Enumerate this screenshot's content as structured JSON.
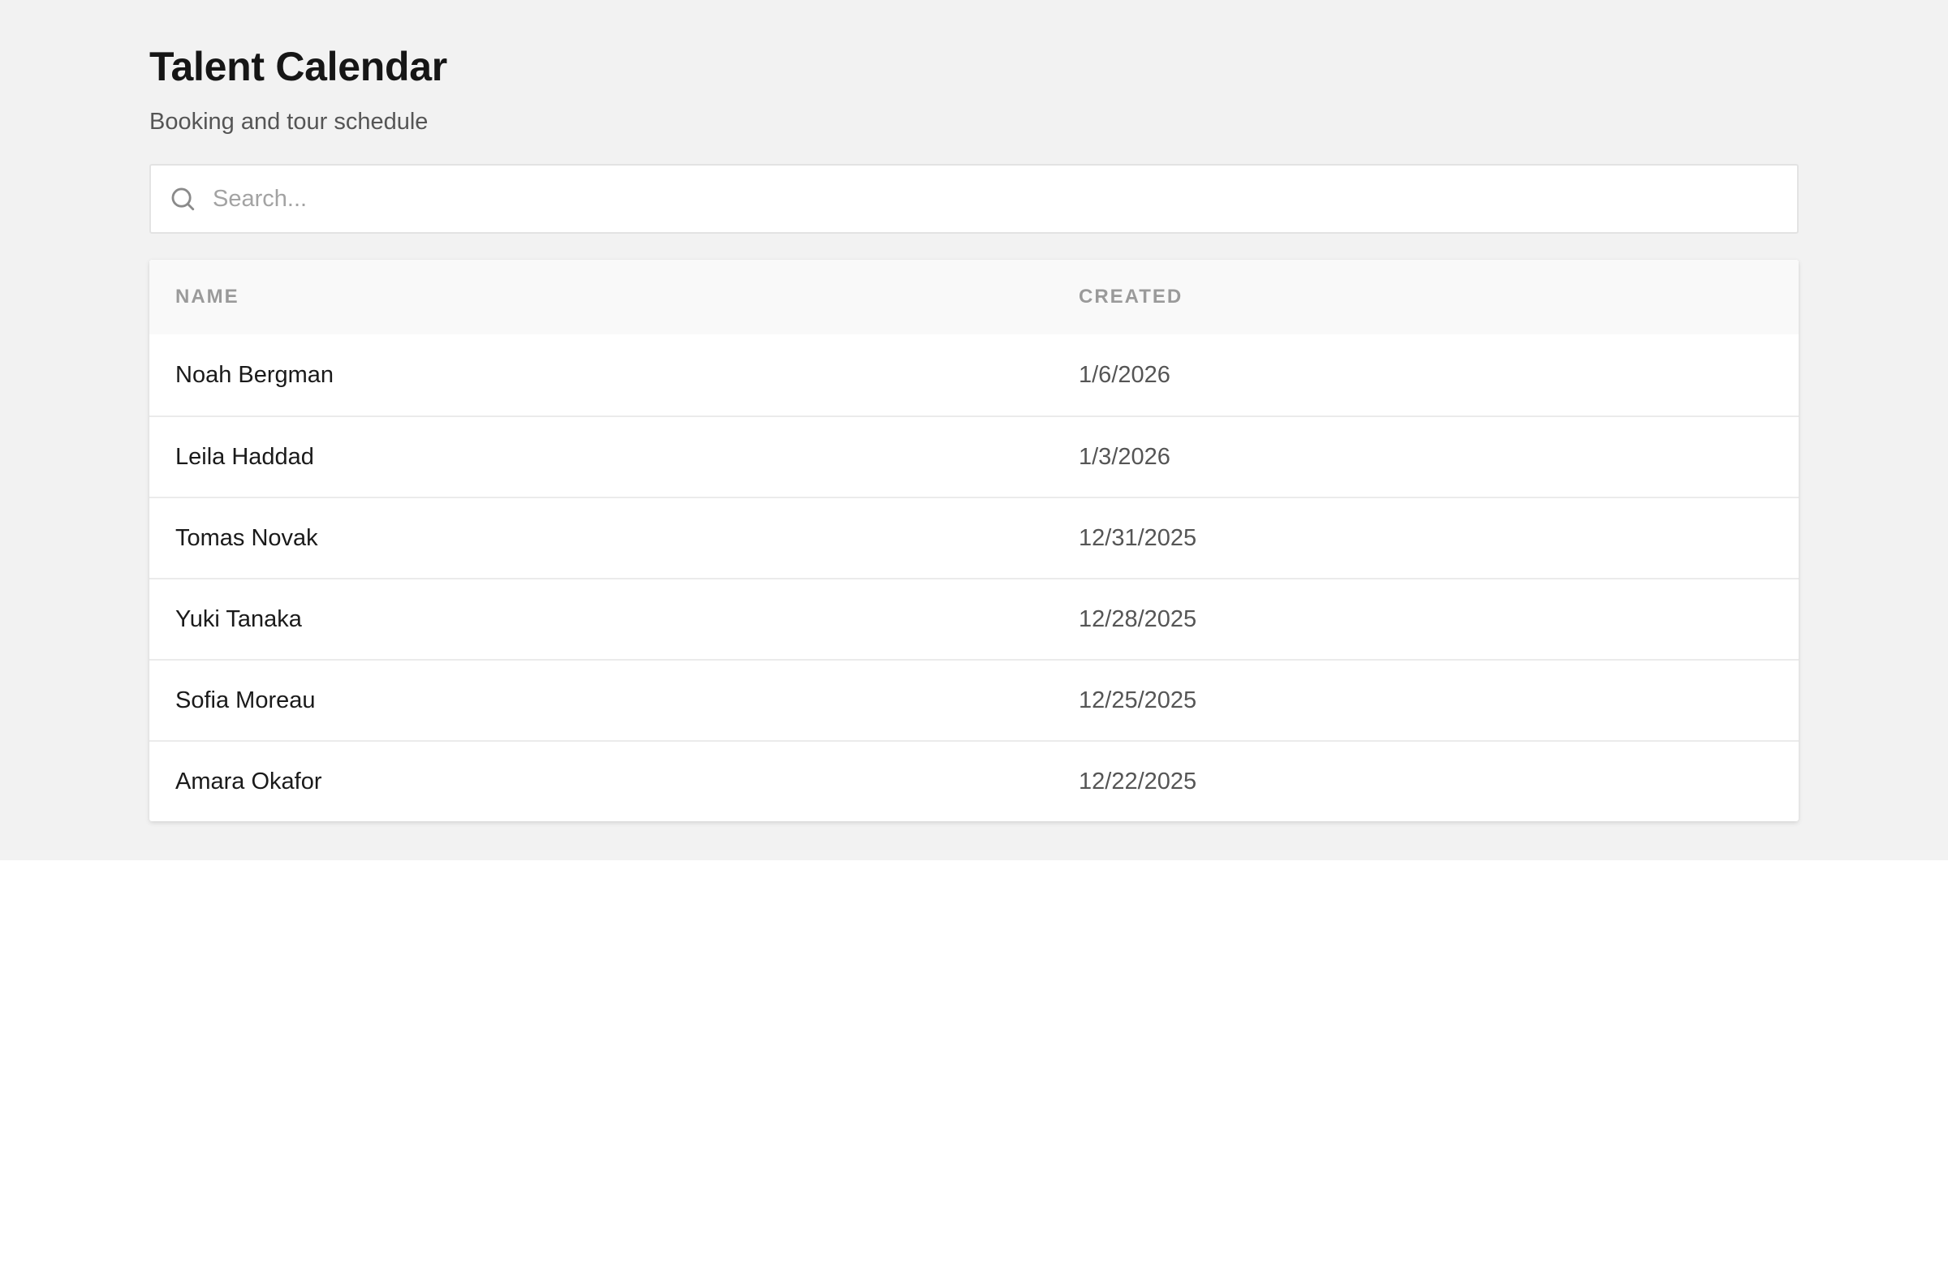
{
  "header": {
    "title": "Talent Calendar",
    "subtitle": "Booking and tour schedule"
  },
  "search": {
    "placeholder": "Search...",
    "value": "",
    "icon": "search-icon"
  },
  "table": {
    "columns": [
      "NAME",
      "CREATED"
    ],
    "rows": [
      {
        "name": "Noah Bergman",
        "created": "1/6/2026"
      },
      {
        "name": "Leila Haddad",
        "created": "1/3/2026"
      },
      {
        "name": "Tomas Novak",
        "created": "12/31/2025"
      },
      {
        "name": "Yuki Tanaka",
        "created": "12/28/2025"
      },
      {
        "name": "Sofia Moreau",
        "created": "12/25/2025"
      },
      {
        "name": "Amara Okafor",
        "created": "12/22/2025"
      }
    ]
  },
  "colors": {
    "background": "#f2f2f2",
    "card": "#ffffff",
    "header_row": "#f9f9f9",
    "title_text": "#161616",
    "muted_text": "#555555",
    "column_header_text": "#9a9a9a"
  }
}
